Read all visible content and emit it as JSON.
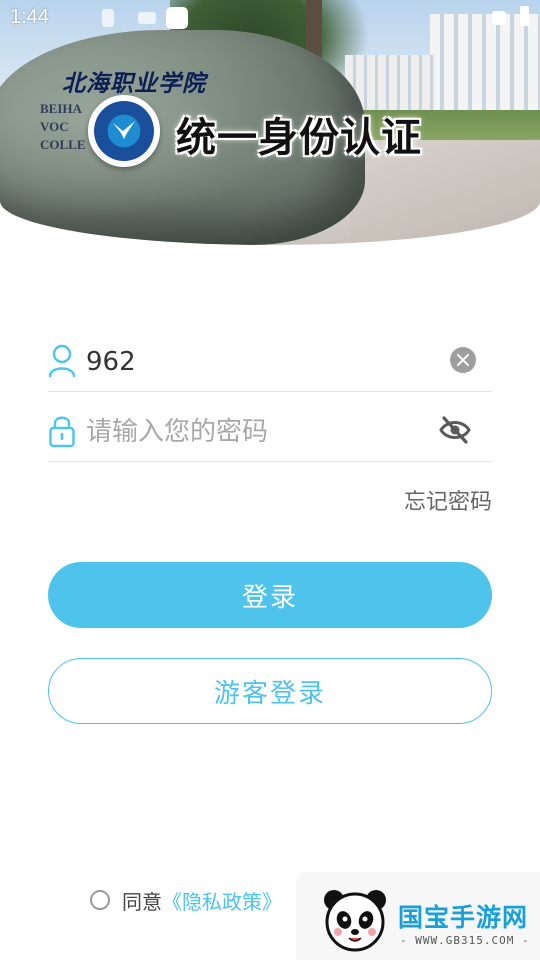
{
  "status_bar": {
    "time": "1:44"
  },
  "header": {
    "school_name_cn": "北海职业学院",
    "school_name_en_lines": [
      "BEIHA",
      "VOC",
      "COLLE"
    ],
    "title": "统一身份认证",
    "logo_icon": "college-emblem-icon"
  },
  "form": {
    "username": {
      "value": "962",
      "icon": "user-icon",
      "clear_icon": "clear-icon"
    },
    "password": {
      "placeholder": "请输入您的密码",
      "icon": "lock-icon",
      "toggle_icon": "eye-off-icon"
    },
    "forgot_label": "忘记密码",
    "login_label": "登录",
    "guest_login_label": "游客登录"
  },
  "agreement": {
    "prefix": "同意",
    "policy_link": "《隐私政策》"
  },
  "watermark": {
    "brand": "国宝手游网",
    "url": "- WWW.GB315.COM -"
  },
  "colors": {
    "accent": "#4ec3ec",
    "text_primary": "#333333",
    "placeholder": "#a8a8a8"
  }
}
